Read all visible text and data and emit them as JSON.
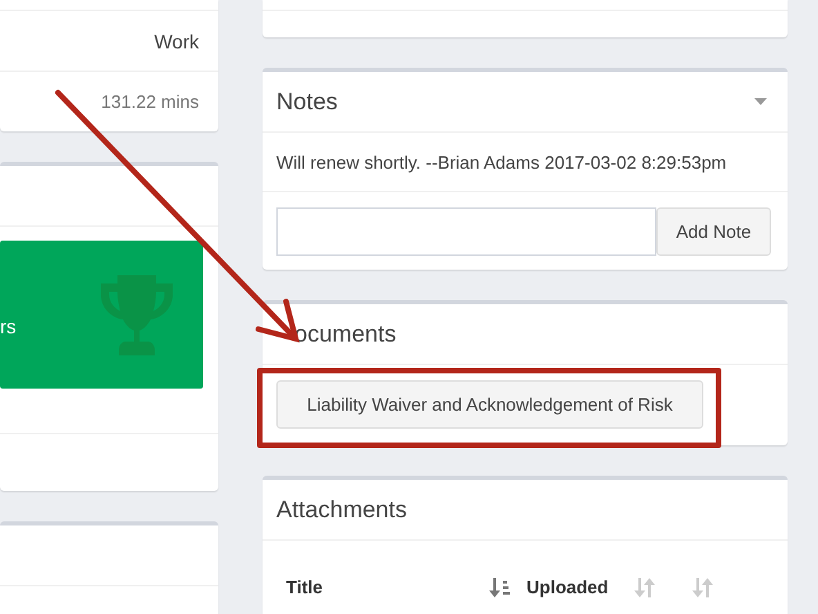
{
  "left_column": {
    "details": [
      {
        "value": "Work"
      },
      {
        "value": "131.22 mins"
      }
    ],
    "achievement_tile": {
      "label": "rs"
    }
  },
  "notes": {
    "title": "Notes",
    "entries": [
      "Will renew shortly. --Brian Adams 2017-03-02 8:29:53pm"
    ],
    "button": "Add Note"
  },
  "documents": {
    "title": "ocuments",
    "items": [
      "Liability Waiver and Acknowledgement of Risk"
    ]
  },
  "attachments": {
    "title": "Attachments",
    "columns": [
      {
        "label": "Title",
        "sorted": true
      },
      {
        "label": "Uploaded",
        "sorted": false
      },
      {
        "sorted": false
      }
    ]
  },
  "annotations": {
    "arrow": true,
    "highlight_box": true
  }
}
